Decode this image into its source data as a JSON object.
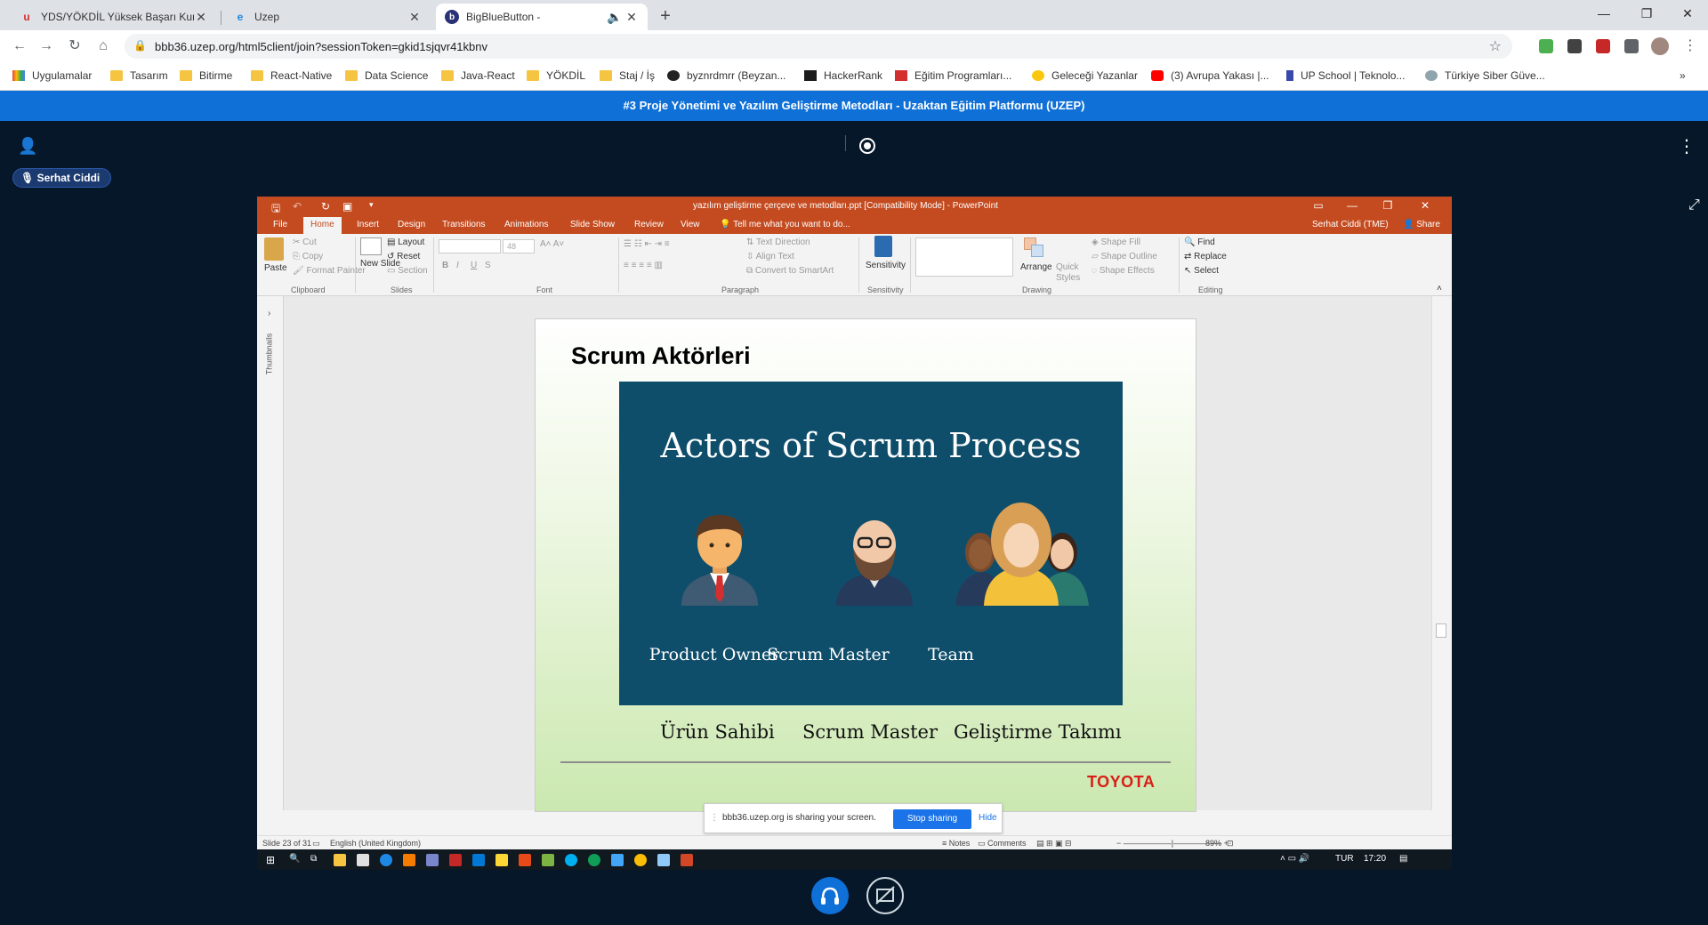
{
  "browser": {
    "tabs": [
      {
        "title": "YDS/YÖKDİL Yüksek Başarı Kursu",
        "active": false
      },
      {
        "title": "Uzep",
        "active": false
      },
      {
        "title": "BigBlueButton -",
        "active": true
      }
    ],
    "url": "bbb36.uzep.org/html5client/join?sessionToken=gkid1sjqvr41kbnv",
    "bookmarks": [
      "Uygulamalar",
      "Tasarım",
      "Bitirme",
      "React-Native",
      "Data Science",
      "Java-React",
      "YÖKDİL",
      "Staj / İş",
      "byznrdmrr (Beyzan...",
      "HackerRank",
      "Eğitim Programları...",
      "Geleceği Yazanlar",
      "(3) Avrupa Yakası |...",
      "UP School | Teknolo...",
      "Türkiye Siber Güve..."
    ]
  },
  "bbb": {
    "banner": "#3 Proje Yönetimi ve Yazılım Geliştirme Metodları - Uzaktan Eğitim Platformu (UZEP)",
    "presenter": "Serhat Ciddi"
  },
  "ppt": {
    "doc_title": "yazılım geliştirme çerçeve ve metodları.ppt [Compatibility Mode] - PowerPoint",
    "menu": [
      "File",
      "Home",
      "Insert",
      "Design",
      "Transitions",
      "Animations",
      "Slide Show",
      "Review",
      "View"
    ],
    "tell_me": "Tell me what you want to do...",
    "user": "Serhat Ciddi (TME)",
    "share": "Share",
    "ribbon": {
      "paste": "Paste",
      "cut": "Cut",
      "copy": "Copy",
      "format_painter": "Format Painter",
      "new_slide": "New Slide",
      "layout": "Layout",
      "reset": "Reset",
      "section": "Section",
      "font_size": "48",
      "text_direction": "Text Direction",
      "align_text": "Align Text",
      "convert_smartart": "Convert to SmartArt",
      "sensitivity": "Sensitivity",
      "arrange": "Arrange",
      "quick_styles": "Quick Styles",
      "shape_fill": "Shape Fill",
      "shape_outline": "Shape Outline",
      "shape_effects": "Shape Effects",
      "find": "Find",
      "replace": "Replace",
      "select": "Select",
      "groups": [
        "Clipboard",
        "Slides",
        "Font",
        "Paragraph",
        "Sensitivity",
        "Drawing",
        "Editing"
      ]
    },
    "thumbnails_label": "Thumbnails",
    "slide": {
      "title": "Scrum Aktörleri",
      "image_title": "Actors of Scrum Process",
      "actors": [
        "Product Owner",
        "Scrum Master",
        "Team"
      ],
      "translations": [
        "Ürün Sahibi",
        "Scrum Master",
        "Geliştirme Takımı"
      ],
      "logo": "TOYOTA"
    },
    "status": {
      "slide": "Slide 23 of 31",
      "language": "English (United Kingdom)",
      "notes": "Notes",
      "comments": "Comments",
      "zoom": "89%"
    },
    "share_notice": {
      "text": "bbb36.uzep.org is sharing your screen.",
      "stop": "Stop sharing",
      "hide": "Hide"
    },
    "taskbar": {
      "lang": "TUR",
      "time": "17:20"
    }
  }
}
